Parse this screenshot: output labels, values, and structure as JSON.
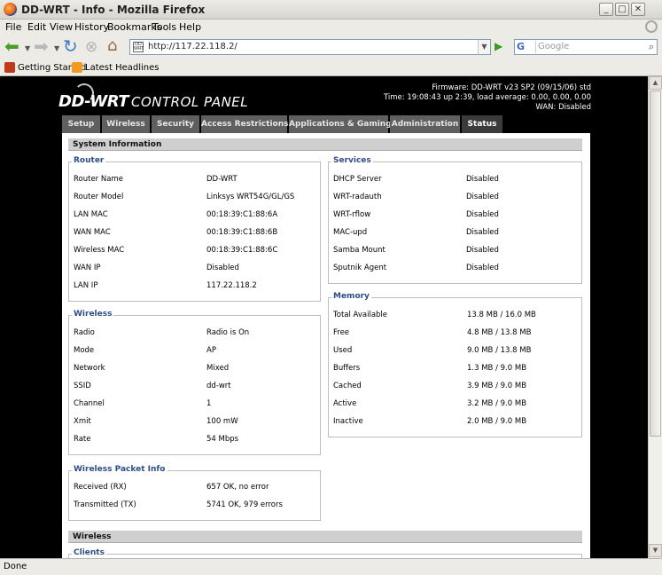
{
  "window": {
    "title": "DD-WRT - Info - Mozilla Firefox"
  },
  "menu": [
    "File",
    "Edit",
    "View",
    "History",
    "Bookmarks",
    "Tools",
    "Help"
  ],
  "toolbar": {
    "url": "http://117.22.118.2/",
    "search_placeholder": "Google",
    "site_icon_text": "DD WRT",
    "search_engine_glyph": "G"
  },
  "bookmarks": [
    "Getting Started",
    "Latest Headlines"
  ],
  "status_text": "Done",
  "page": {
    "logo_brand": "DD-WRT",
    "logo_panel": "CONTROL PANEL",
    "firmware": "Firmware: DD-WRT v23 SP2 (09/15/06) std",
    "time": "Time: 19:08:43 up 2:39, load average: 0.00, 0.00, 0.00",
    "wan": "WAN: Disabled",
    "tabs": [
      "Setup",
      "Wireless",
      "Security",
      "Access Restrictions",
      "Applications & Gaming",
      "Administration",
      "Status"
    ],
    "sys_info_title": "System Information",
    "wireless_section_title": "Wireless",
    "router": {
      "legend": "Router",
      "rows": [
        {
          "label": "Router Name",
          "value": "DD-WRT"
        },
        {
          "label": "Router Model",
          "value": "Linksys WRT54G/GL/GS"
        },
        {
          "label": "LAN MAC",
          "value": "00:18:39:C1:88:6A"
        },
        {
          "label": "WAN MAC",
          "value": "00:18:39:C1:88:6B"
        },
        {
          "label": "Wireless MAC",
          "value": "00:18:39:C1:88:6C"
        },
        {
          "label": "WAN IP",
          "value": "Disabled"
        },
        {
          "label": "LAN IP",
          "value": "117.22.118.2"
        }
      ]
    },
    "services": {
      "legend": "Services",
      "rows": [
        {
          "label": "DHCP Server",
          "value": "Disabled"
        },
        {
          "label": "WRT-radauth",
          "value": "Disabled"
        },
        {
          "label": "WRT-rflow",
          "value": "Disabled"
        },
        {
          "label": "MAC-upd",
          "value": "Disabled"
        },
        {
          "label": "Samba Mount",
          "value": "Disabled"
        },
        {
          "label": "Sputnik Agent",
          "value": "Disabled"
        }
      ]
    },
    "wireless": {
      "legend": "Wireless",
      "rows": [
        {
          "label": "Radio",
          "value": "Radio is On"
        },
        {
          "label": "Mode",
          "value": "AP"
        },
        {
          "label": "Network",
          "value": "Mixed"
        },
        {
          "label": "SSID",
          "value": "dd-wrt"
        },
        {
          "label": "Channel",
          "value": "1"
        },
        {
          "label": "Xmit",
          "value": "100 mW"
        },
        {
          "label": "Rate",
          "value": "54 Mbps"
        }
      ]
    },
    "memory": {
      "legend": "Memory",
      "rows": [
        {
          "label": "Total Available",
          "value": "13.8 MB / 16.0 MB"
        },
        {
          "label": "Free",
          "value": "4.8 MB / 13.8 MB"
        },
        {
          "label": "Used",
          "value": "9.0 MB / 13.8 MB"
        },
        {
          "label": "Buffers",
          "value": "1.3 MB / 9.0 MB"
        },
        {
          "label": "Cached",
          "value": "3.9 MB / 9.0 MB"
        },
        {
          "label": "Active",
          "value": "3.2 MB / 9.0 MB"
        },
        {
          "label": "Inactive",
          "value": "2.0 MB / 9.0 MB"
        }
      ]
    },
    "packet_info": {
      "legend": "Wireless Packet Info",
      "rows": [
        {
          "label": "Received (RX)",
          "value": "657 OK, no error"
        },
        {
          "label": "Transmitted (TX)",
          "value": "5741 OK, 979 errors"
        }
      ]
    },
    "clients": {
      "legend": "Clients"
    }
  }
}
